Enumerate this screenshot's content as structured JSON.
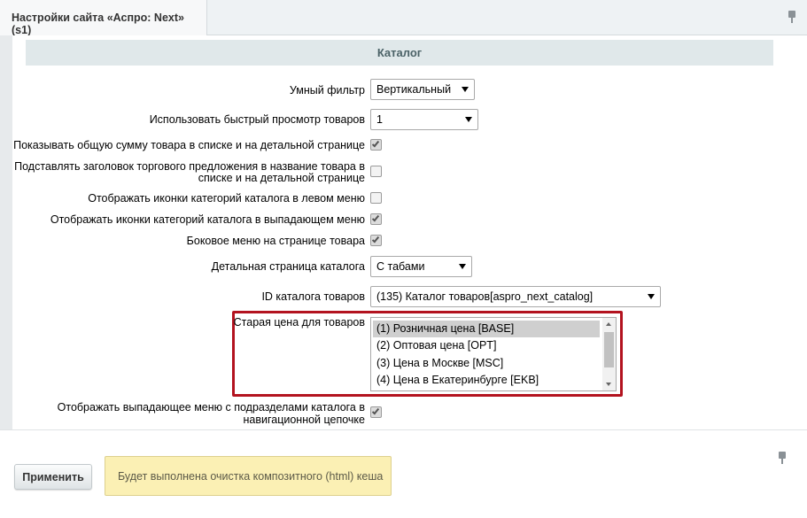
{
  "tab": {
    "title": "Настройки сайта «Аспро: Next» (s1)"
  },
  "section": {
    "title": "Каталог"
  },
  "fields": {
    "smart_filter": {
      "label": "Умный фильтр",
      "value": "Вертикальный"
    },
    "quick_view": {
      "label": "Использовать быстрый просмотр товаров",
      "value": "1"
    },
    "show_total_sum": {
      "label": "Показывать общую сумму товара в списке и на детальной странице",
      "checked": true
    },
    "offer_title_line1": {
      "label": "Подставлять заголовок торгового предложения в название товара в",
      "checked": false
    },
    "offer_title_line2": {
      "label": "списке и на детальной странице"
    },
    "left_menu_icons": {
      "label": "Отображать иконки категорий каталога в левом меню",
      "checked": false
    },
    "dropdown_menu_icons": {
      "label": "Отображать иконки категорий каталога в выпадающем меню",
      "checked": true
    },
    "side_menu_product": {
      "label": "Боковое меню на странице товара",
      "checked": true
    },
    "detail_page": {
      "label": "Детальная страница каталога",
      "value": "С табами"
    },
    "catalog_id": {
      "label": "ID каталога товаров",
      "value": "(135) Каталог товаров[aspro_next_catalog]"
    },
    "old_price": {
      "label": "Старая цена для товаров",
      "options": [
        "(1) Розничная цена [BASE]",
        "(2) Оптовая цена [OPT]",
        "(3) Цена в Москве [MSC]",
        "(4) Цена в Екатеринбурге [EKB]"
      ],
      "selected_index": 0
    },
    "breadcrumb_dropdown_line1": {
      "label": "Отображать выпадающее меню с подразделами каталога в",
      "checked": true
    },
    "breadcrumb_dropdown_line2": {
      "label": "навигационной цепочке"
    }
  },
  "footer": {
    "apply_label": "Применить",
    "notice": "Будет выполнена очистка композитного (html) кеша"
  },
  "colors": {
    "highlight_border": "#b3131f",
    "section_header_bg": "#e0e8ea",
    "notice_bg": "#fbf0b4"
  },
  "icons": [
    "pin-icon",
    "checkbox-check-icon",
    "dropdown-arrow-icon",
    "scroll-up-icon",
    "scroll-down-icon"
  ]
}
